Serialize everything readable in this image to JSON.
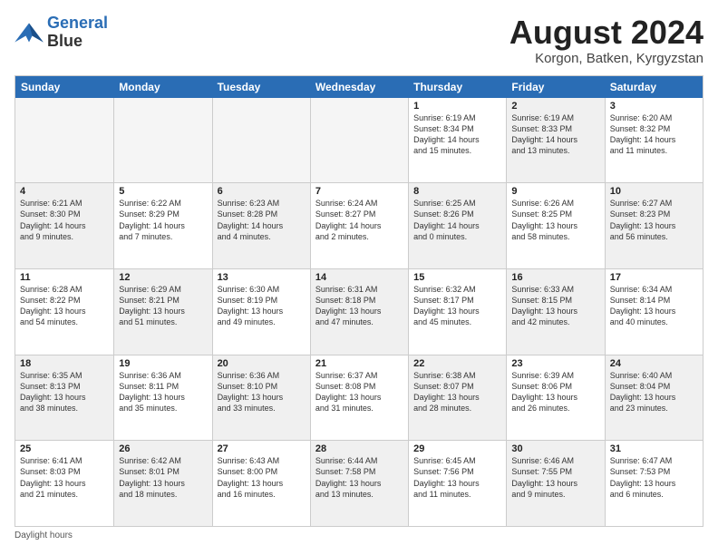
{
  "header": {
    "logo": {
      "line1": "General",
      "line2": "Blue"
    },
    "month_year": "August 2024",
    "location": "Korgon, Batken, Kyrgyzstan"
  },
  "weekdays": [
    "Sunday",
    "Monday",
    "Tuesday",
    "Wednesday",
    "Thursday",
    "Friday",
    "Saturday"
  ],
  "rows": [
    [
      {
        "day": "",
        "text": "",
        "empty": true
      },
      {
        "day": "",
        "text": "",
        "empty": true
      },
      {
        "day": "",
        "text": "",
        "empty": true
      },
      {
        "day": "",
        "text": "",
        "empty": true
      },
      {
        "day": "1",
        "text": "Sunrise: 6:19 AM\nSunset: 8:34 PM\nDaylight: 14 hours\nand 15 minutes."
      },
      {
        "day": "2",
        "text": "Sunrise: 6:19 AM\nSunset: 8:33 PM\nDaylight: 14 hours\nand 13 minutes.",
        "shaded": true
      },
      {
        "day": "3",
        "text": "Sunrise: 6:20 AM\nSunset: 8:32 PM\nDaylight: 14 hours\nand 11 minutes."
      }
    ],
    [
      {
        "day": "4",
        "text": "Sunrise: 6:21 AM\nSunset: 8:30 PM\nDaylight: 14 hours\nand 9 minutes.",
        "shaded": true
      },
      {
        "day": "5",
        "text": "Sunrise: 6:22 AM\nSunset: 8:29 PM\nDaylight: 14 hours\nand 7 minutes."
      },
      {
        "day": "6",
        "text": "Sunrise: 6:23 AM\nSunset: 8:28 PM\nDaylight: 14 hours\nand 4 minutes.",
        "shaded": true
      },
      {
        "day": "7",
        "text": "Sunrise: 6:24 AM\nSunset: 8:27 PM\nDaylight: 14 hours\nand 2 minutes."
      },
      {
        "day": "8",
        "text": "Sunrise: 6:25 AM\nSunset: 8:26 PM\nDaylight: 14 hours\nand 0 minutes.",
        "shaded": true
      },
      {
        "day": "9",
        "text": "Sunrise: 6:26 AM\nSunset: 8:25 PM\nDaylight: 13 hours\nand 58 minutes."
      },
      {
        "day": "10",
        "text": "Sunrise: 6:27 AM\nSunset: 8:23 PM\nDaylight: 13 hours\nand 56 minutes.",
        "shaded": true
      }
    ],
    [
      {
        "day": "11",
        "text": "Sunrise: 6:28 AM\nSunset: 8:22 PM\nDaylight: 13 hours\nand 54 minutes."
      },
      {
        "day": "12",
        "text": "Sunrise: 6:29 AM\nSunset: 8:21 PM\nDaylight: 13 hours\nand 51 minutes.",
        "shaded": true
      },
      {
        "day": "13",
        "text": "Sunrise: 6:30 AM\nSunset: 8:19 PM\nDaylight: 13 hours\nand 49 minutes."
      },
      {
        "day": "14",
        "text": "Sunrise: 6:31 AM\nSunset: 8:18 PM\nDaylight: 13 hours\nand 47 minutes.",
        "shaded": true
      },
      {
        "day": "15",
        "text": "Sunrise: 6:32 AM\nSunset: 8:17 PM\nDaylight: 13 hours\nand 45 minutes."
      },
      {
        "day": "16",
        "text": "Sunrise: 6:33 AM\nSunset: 8:15 PM\nDaylight: 13 hours\nand 42 minutes.",
        "shaded": true
      },
      {
        "day": "17",
        "text": "Sunrise: 6:34 AM\nSunset: 8:14 PM\nDaylight: 13 hours\nand 40 minutes."
      }
    ],
    [
      {
        "day": "18",
        "text": "Sunrise: 6:35 AM\nSunset: 8:13 PM\nDaylight: 13 hours\nand 38 minutes.",
        "shaded": true
      },
      {
        "day": "19",
        "text": "Sunrise: 6:36 AM\nSunset: 8:11 PM\nDaylight: 13 hours\nand 35 minutes."
      },
      {
        "day": "20",
        "text": "Sunrise: 6:36 AM\nSunset: 8:10 PM\nDaylight: 13 hours\nand 33 minutes.",
        "shaded": true
      },
      {
        "day": "21",
        "text": "Sunrise: 6:37 AM\nSunset: 8:08 PM\nDaylight: 13 hours\nand 31 minutes."
      },
      {
        "day": "22",
        "text": "Sunrise: 6:38 AM\nSunset: 8:07 PM\nDaylight: 13 hours\nand 28 minutes.",
        "shaded": true
      },
      {
        "day": "23",
        "text": "Sunrise: 6:39 AM\nSunset: 8:06 PM\nDaylight: 13 hours\nand 26 minutes."
      },
      {
        "day": "24",
        "text": "Sunrise: 6:40 AM\nSunset: 8:04 PM\nDaylight: 13 hours\nand 23 minutes.",
        "shaded": true
      }
    ],
    [
      {
        "day": "25",
        "text": "Sunrise: 6:41 AM\nSunset: 8:03 PM\nDaylight: 13 hours\nand 21 minutes."
      },
      {
        "day": "26",
        "text": "Sunrise: 6:42 AM\nSunset: 8:01 PM\nDaylight: 13 hours\nand 18 minutes.",
        "shaded": true
      },
      {
        "day": "27",
        "text": "Sunrise: 6:43 AM\nSunset: 8:00 PM\nDaylight: 13 hours\nand 16 minutes."
      },
      {
        "day": "28",
        "text": "Sunrise: 6:44 AM\nSunset: 7:58 PM\nDaylight: 13 hours\nand 13 minutes.",
        "shaded": true
      },
      {
        "day": "29",
        "text": "Sunrise: 6:45 AM\nSunset: 7:56 PM\nDaylight: 13 hours\nand 11 minutes."
      },
      {
        "day": "30",
        "text": "Sunrise: 6:46 AM\nSunset: 7:55 PM\nDaylight: 13 hours\nand 9 minutes.",
        "shaded": true
      },
      {
        "day": "31",
        "text": "Sunrise: 6:47 AM\nSunset: 7:53 PM\nDaylight: 13 hours\nand 6 minutes."
      }
    ]
  ],
  "footer": "Daylight hours"
}
